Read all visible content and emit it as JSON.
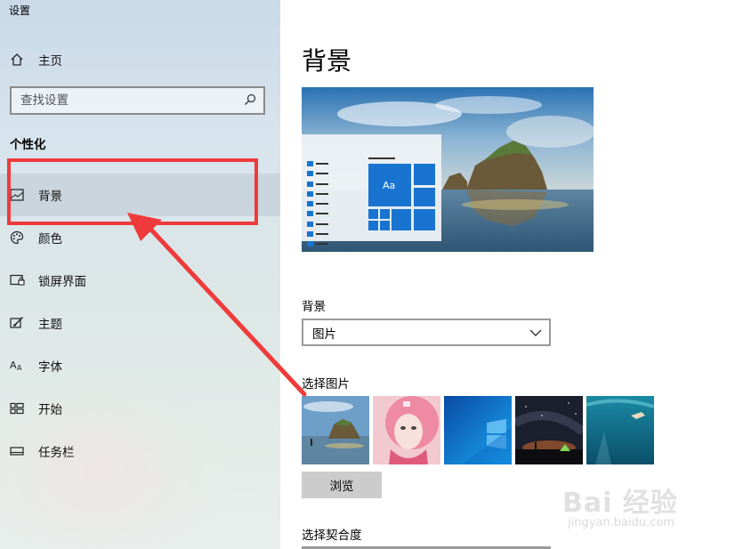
{
  "app": {
    "title": "设置"
  },
  "sidebar": {
    "home_label": "主页",
    "search_placeholder": "查找设置",
    "section_title": "个性化",
    "items": [
      {
        "label": "背景",
        "icon": "picture-icon",
        "selected": true
      },
      {
        "label": "颜色",
        "icon": "palette-icon",
        "selected": false
      },
      {
        "label": "锁屏界面",
        "icon": "lock-screen-icon",
        "selected": false
      },
      {
        "label": "主题",
        "icon": "theme-brush-icon",
        "selected": false
      },
      {
        "label": "字体",
        "icon": "font-icon",
        "selected": false
      },
      {
        "label": "开始",
        "icon": "start-grid-icon",
        "selected": false
      },
      {
        "label": "任务栏",
        "icon": "taskbar-icon",
        "selected": false
      }
    ]
  },
  "main": {
    "page_title": "背景",
    "preview": {
      "tile_label": "Aa"
    },
    "background_label": "背景",
    "background_select_value": "图片",
    "choose_picture_label": "选择图片",
    "thumbnails": [
      {
        "name": "coastal-rock-beach"
      },
      {
        "name": "pink-hair-portrait"
      },
      {
        "name": "windows-blue"
      },
      {
        "name": "starry-night-camping"
      },
      {
        "name": "underwater-swimmer"
      }
    ],
    "browse_label": "浏览",
    "choose_fit_label": "选择契合度"
  },
  "annotation": {
    "highlight_color": "#ef3b3b"
  },
  "watermark": {
    "brand": "Bai 经验",
    "url": "jingyan.baidu.com"
  },
  "colors": {
    "accent": "#1874d0",
    "sidebar_selected": "#c4ccd4"
  }
}
